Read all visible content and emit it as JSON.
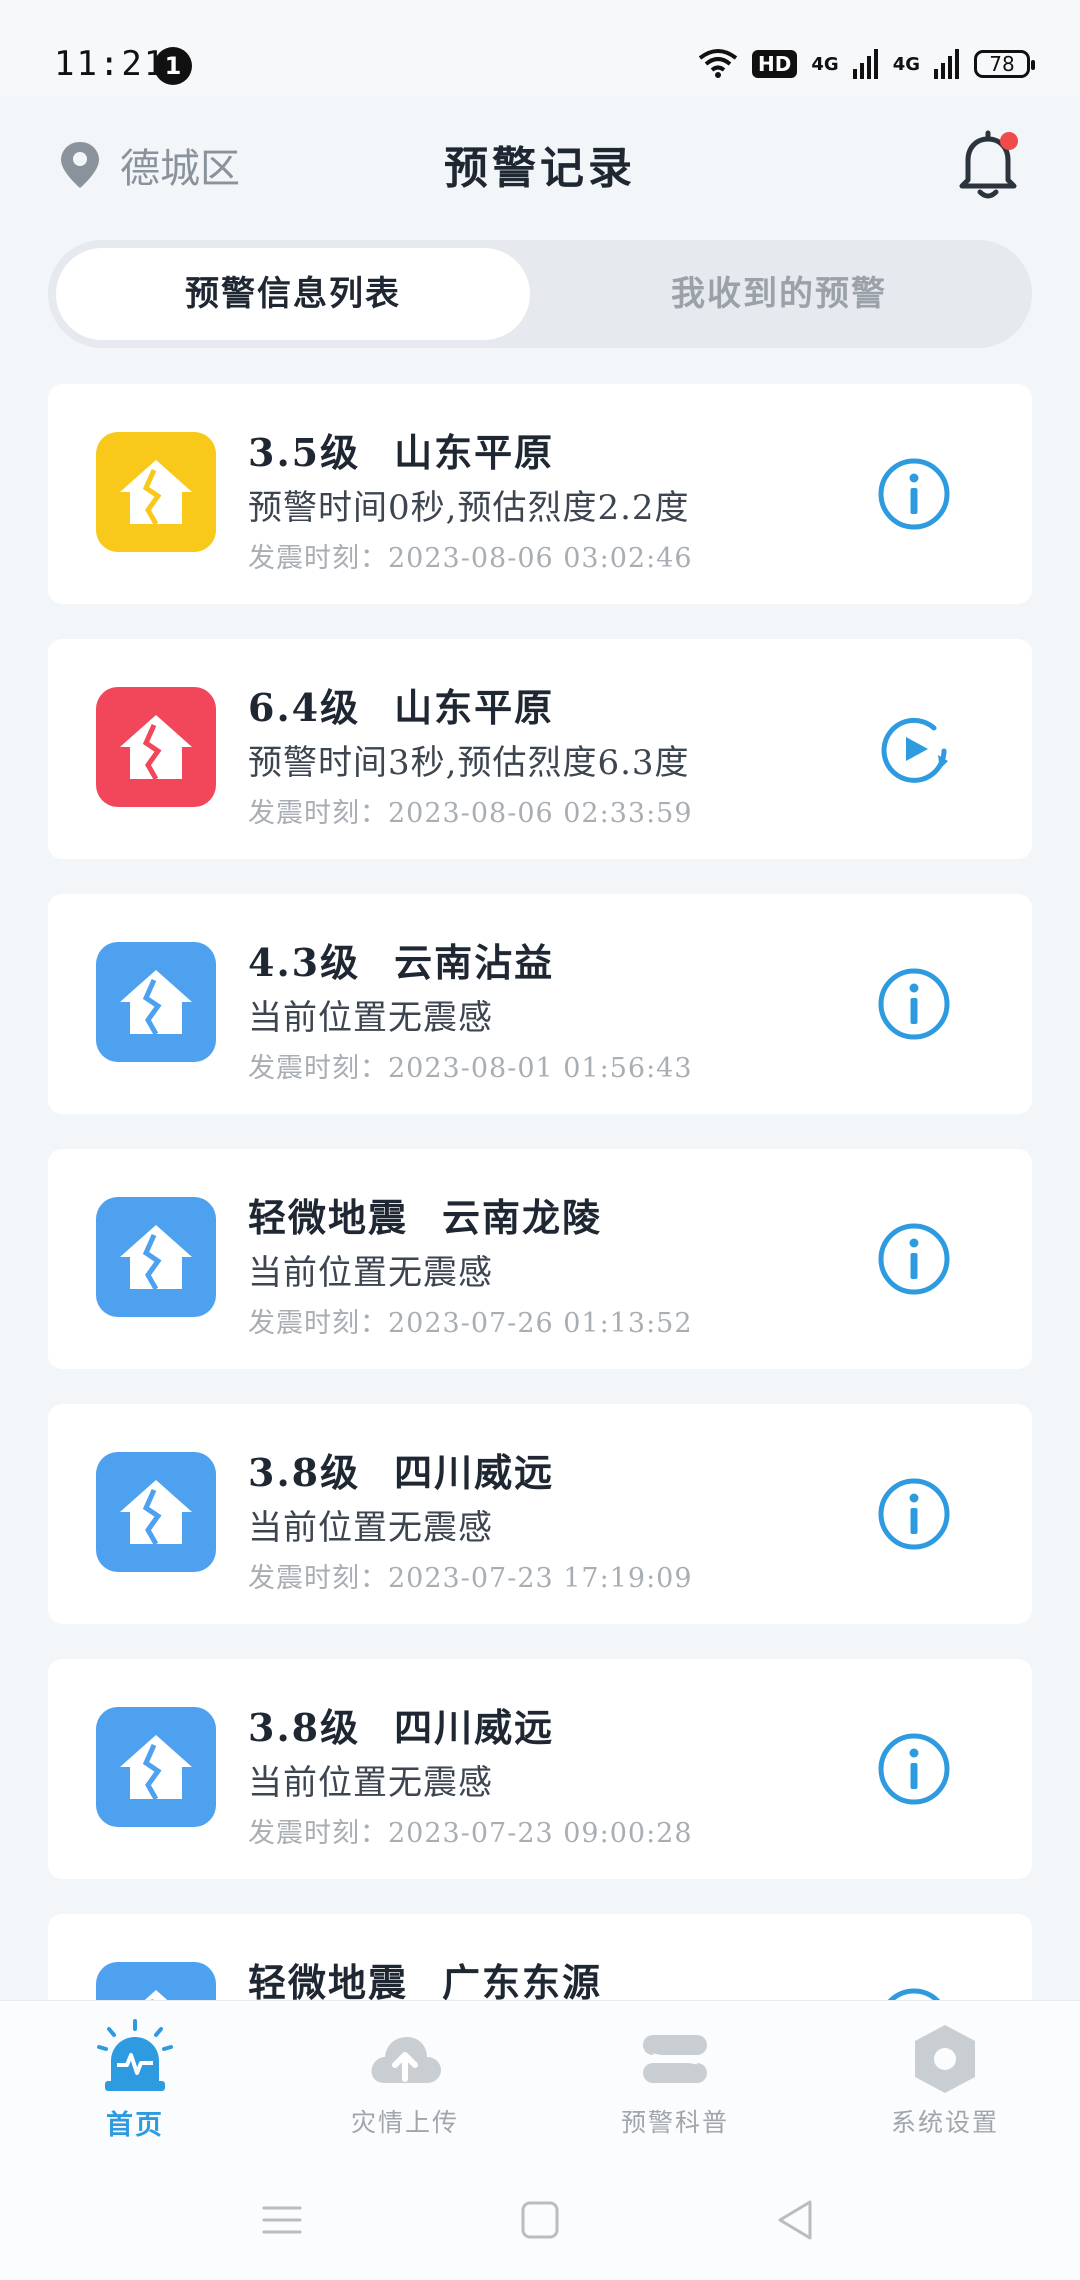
{
  "status_bar": {
    "time": "11:21",
    "notification_count": "1",
    "hd_label": "HD",
    "net1": "4G",
    "net2": "4G",
    "battery": "78"
  },
  "header": {
    "location": "德城区",
    "title": "预警记录",
    "has_unread": true
  },
  "tabs": {
    "active": "预警信息列表",
    "inactive": "我收到的预警"
  },
  "records": [
    {
      "magnitude": "3.5级",
      "place": "山东平原",
      "detail": "预警时间0秒,预估烈度2.2度",
      "time": "发震时刻：2023-08-06 03:02:46",
      "level_color": "#f8c81b",
      "action": "info-icon"
    },
    {
      "magnitude": "6.4级",
      "place": "山东平原",
      "detail": "预警时间3秒,预估烈度6.3度",
      "time": "发震时刻：2023-08-06 02:33:59",
      "level_color": "#f2475a",
      "action": "replay-icon"
    },
    {
      "magnitude": "4.3级",
      "place": "云南沾益",
      "detail": "当前位置无震感",
      "time": "发震时刻：2023-08-01 01:56:43",
      "level_color": "#4ea1ee",
      "action": "info-icon"
    },
    {
      "magnitude": "轻微地震",
      "place": "云南龙陵",
      "detail": "当前位置无震感",
      "time": "发震时刻：2023-07-26 01:13:52",
      "level_color": "#4ea1ee",
      "action": "info-icon"
    },
    {
      "magnitude": "3.8级",
      "place": "四川威远",
      "detail": "当前位置无震感",
      "time": "发震时刻：2023-07-23 17:19:09",
      "level_color": "#4ea1ee",
      "action": "info-icon"
    },
    {
      "magnitude": "3.8级",
      "place": "四川威远",
      "detail": "当前位置无震感",
      "time": "发震时刻：2023-07-23 09:00:28",
      "level_color": "#4ea1ee",
      "action": "info-icon"
    },
    {
      "magnitude": "轻微地震",
      "place": "广东东源",
      "detail": "",
      "time": "",
      "level_color": "#4ea1ee",
      "action": "info-icon"
    }
  ],
  "bottom_nav": [
    {
      "label": "首页",
      "icon": "alarm-icon",
      "active": true
    },
    {
      "label": "灾情上传",
      "icon": "cloud-upload-icon",
      "active": false
    },
    {
      "label": "预警科普",
      "icon": "book-icon",
      "active": false
    },
    {
      "label": "系统设置",
      "icon": "settings-hex-icon",
      "active": false
    }
  ],
  "colors": {
    "accent": "#2e9be0",
    "minor": "#4ea1ee",
    "moderate": "#f8c81b",
    "strong": "#f2475a"
  }
}
